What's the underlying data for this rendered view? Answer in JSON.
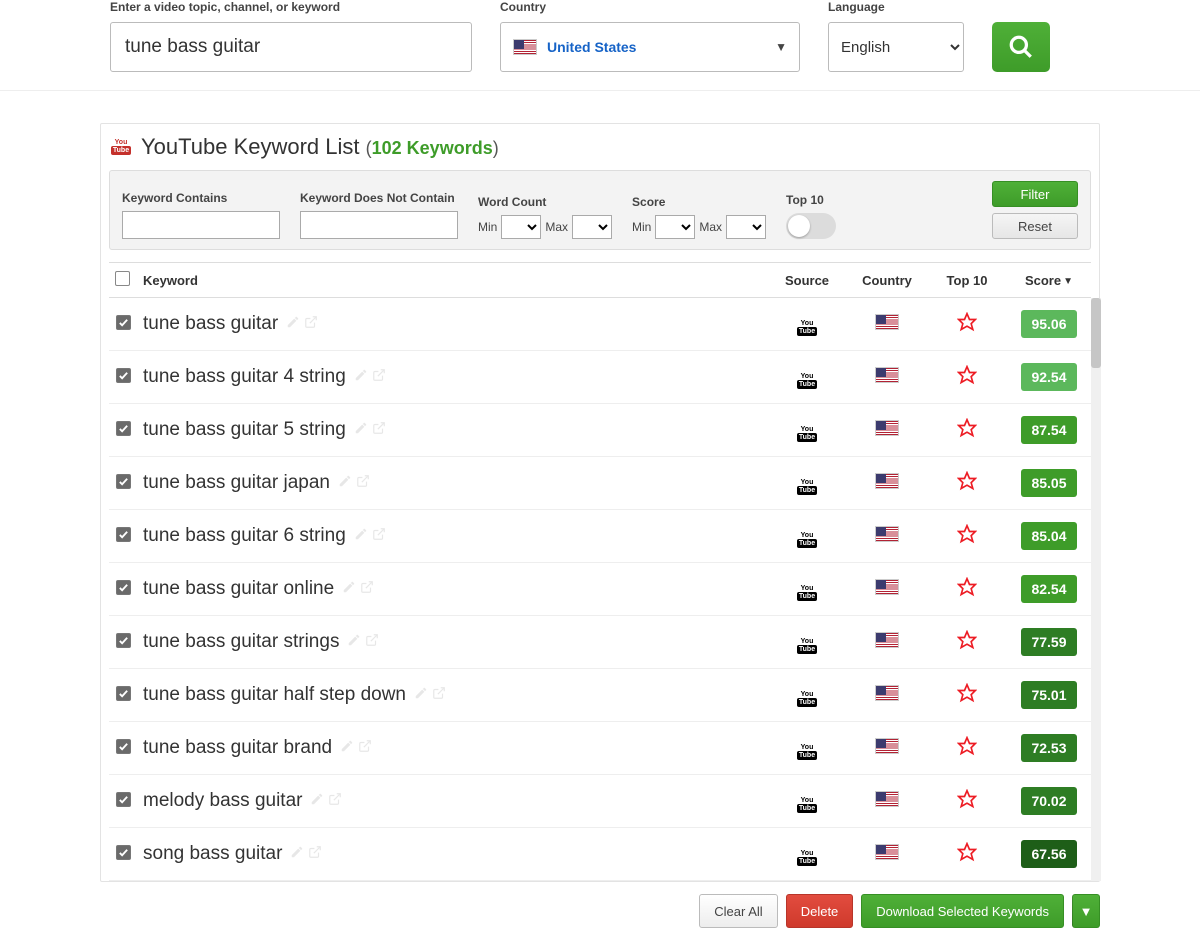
{
  "search": {
    "topic_label": "Enter a video topic, channel, or keyword",
    "topic_value": "tune bass guitar",
    "country_label": "Country",
    "country_value": "United States",
    "language_label": "Language",
    "language_value": "English"
  },
  "panel": {
    "title": "YouTube Keyword List",
    "count_label": "102 Keywords"
  },
  "filters": {
    "contains_label": "Keyword Contains",
    "not_contain_label": "Keyword Does Not Contain",
    "word_count_label": "Word Count",
    "score_label": "Score",
    "top10_label": "Top 10",
    "min": "Min",
    "max": "Max",
    "filter_btn": "Filter",
    "reset_btn": "Reset"
  },
  "table": {
    "headers": {
      "keyword": "Keyword",
      "source": "Source",
      "country": "Country",
      "top10": "Top 10",
      "score": "Score"
    }
  },
  "rows": [
    {
      "keyword": "tune bass guitar",
      "score": "95.06",
      "score_color": "#5cb85c"
    },
    {
      "keyword": "tune bass guitar 4 string",
      "score": "92.54",
      "score_color": "#5cb85c"
    },
    {
      "keyword": "tune bass guitar 5 string",
      "score": "87.54",
      "score_color": "#3e9c29"
    },
    {
      "keyword": "tune bass guitar japan",
      "score": "85.05",
      "score_color": "#3e9c29"
    },
    {
      "keyword": "tune bass guitar 6 string",
      "score": "85.04",
      "score_color": "#3e9c29"
    },
    {
      "keyword": "tune bass guitar online",
      "score": "82.54",
      "score_color": "#3e9c29"
    },
    {
      "keyword": "tune bass guitar strings",
      "score": "77.59",
      "score_color": "#2e7d24"
    },
    {
      "keyword": "tune bass guitar half step down",
      "score": "75.01",
      "score_color": "#2e7d24"
    },
    {
      "keyword": "tune bass guitar brand",
      "score": "72.53",
      "score_color": "#2e7d24"
    },
    {
      "keyword": "melody bass guitar",
      "score": "70.02",
      "score_color": "#2e7d24"
    },
    {
      "keyword": "song bass guitar",
      "score": "67.56",
      "score_color": "#1e5e18"
    }
  ],
  "footer": {
    "clear_all": "Clear All",
    "delete": "Delete",
    "download": "Download Selected Keywords"
  }
}
